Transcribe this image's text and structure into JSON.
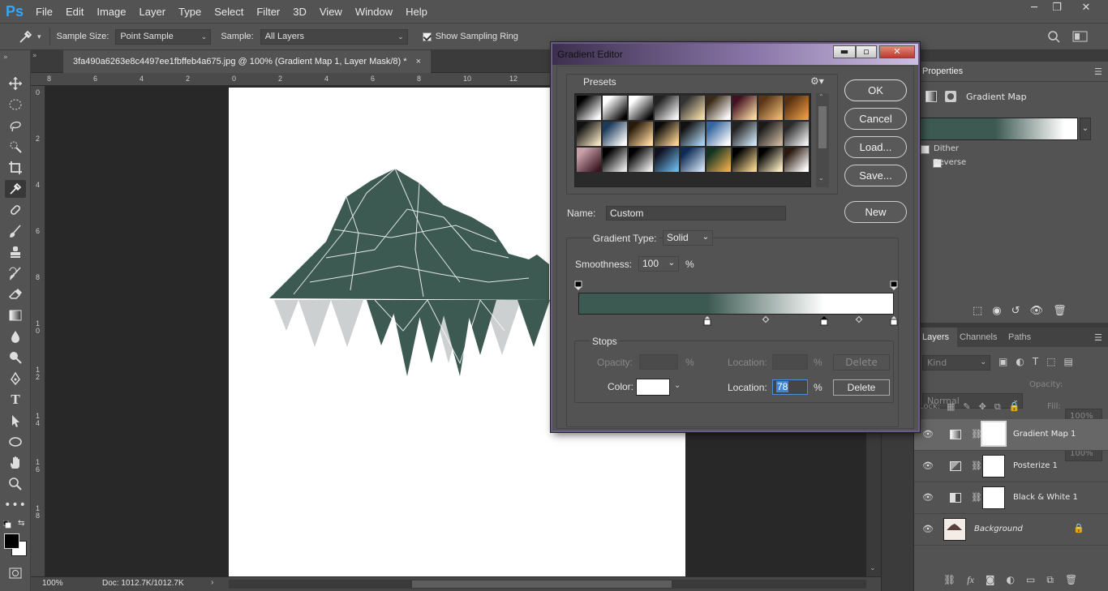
{
  "app": {
    "logo": "Ps"
  },
  "menu": [
    "File",
    "Edit",
    "Image",
    "Layer",
    "Type",
    "Select",
    "Filter",
    "3D",
    "View",
    "Window",
    "Help"
  ],
  "window_controls": [
    "─",
    "❐",
    "✕"
  ],
  "options_bar": {
    "tool_icon": "eyedropper-icon",
    "sample_size_label": "Sample Size:",
    "sample_size_value": "Point Sample",
    "sample_label": "Sample:",
    "sample_value": "All Layers",
    "show_ring_label": "Show Sampling Ring",
    "show_ring_checked": true
  },
  "document_tab": {
    "title": "3fa490a6263e8c4497ee1fbffeb4a675.jpg @ 100% (Gradient Map 1, Layer Mask/8) *",
    "close": "×"
  },
  "ruler_h": [
    "8",
    "6",
    "4",
    "2",
    "0",
    "2",
    "4",
    "6",
    "8",
    "10",
    "12"
  ],
  "ruler_v": [
    "0",
    "2",
    "4",
    "6",
    "8",
    "1\n0",
    "1\n2",
    "1\n4",
    "1\n6",
    "1\n8"
  ],
  "status": {
    "zoom": "100%",
    "doc": "Doc: 1012.7K/1012.7K"
  },
  "properties": {
    "tab": "Properties",
    "title": "Gradient Map",
    "dither_label": "Dither",
    "reverse_label": "Reverse",
    "gradient_colors": [
      "#3d5a52",
      "#ffffff"
    ]
  },
  "layers_panel": {
    "tabs": [
      "Layers",
      "Channels",
      "Paths"
    ],
    "kind": "Kind",
    "blend": "Normal",
    "opacity_label": "Opacity:",
    "opacity_value": "100%",
    "lock_label": "Lock:",
    "fill_label": "Fill:",
    "fill_value": "100%",
    "layers": [
      {
        "name": "Gradient Map 1",
        "selected": true
      },
      {
        "name": "Posterize 1",
        "selected": false
      },
      {
        "name": "Black & White 1",
        "selected": false
      },
      {
        "name": "Background",
        "selected": false,
        "locked": true
      }
    ]
  },
  "gradient_editor": {
    "title": "Gradient Editor",
    "presets_label": "Presets",
    "buttons": {
      "ok": "OK",
      "cancel": "Cancel",
      "load": "Load...",
      "save": "Save...",
      "new": "New"
    },
    "name_label": "Name:",
    "name_value": "Custom",
    "gradient_type_label": "Gradient Type:",
    "gradient_type_value": "Solid",
    "smoothness_label": "Smoothness:",
    "smoothness_value": "100",
    "percent": "%",
    "stops_label": "Stops",
    "opacity_label": "Opacity:",
    "location_label": "Location:",
    "color_label": "Color:",
    "delete_label": "Delete",
    "color_location_value": "78",
    "ramp_colors": {
      "dark": "#3d5a52",
      "light": "#ffffff"
    },
    "color_stops_location_pct": [
      41,
      78,
      100
    ],
    "opacity_stops_location_pct": [
      0,
      100
    ]
  }
}
